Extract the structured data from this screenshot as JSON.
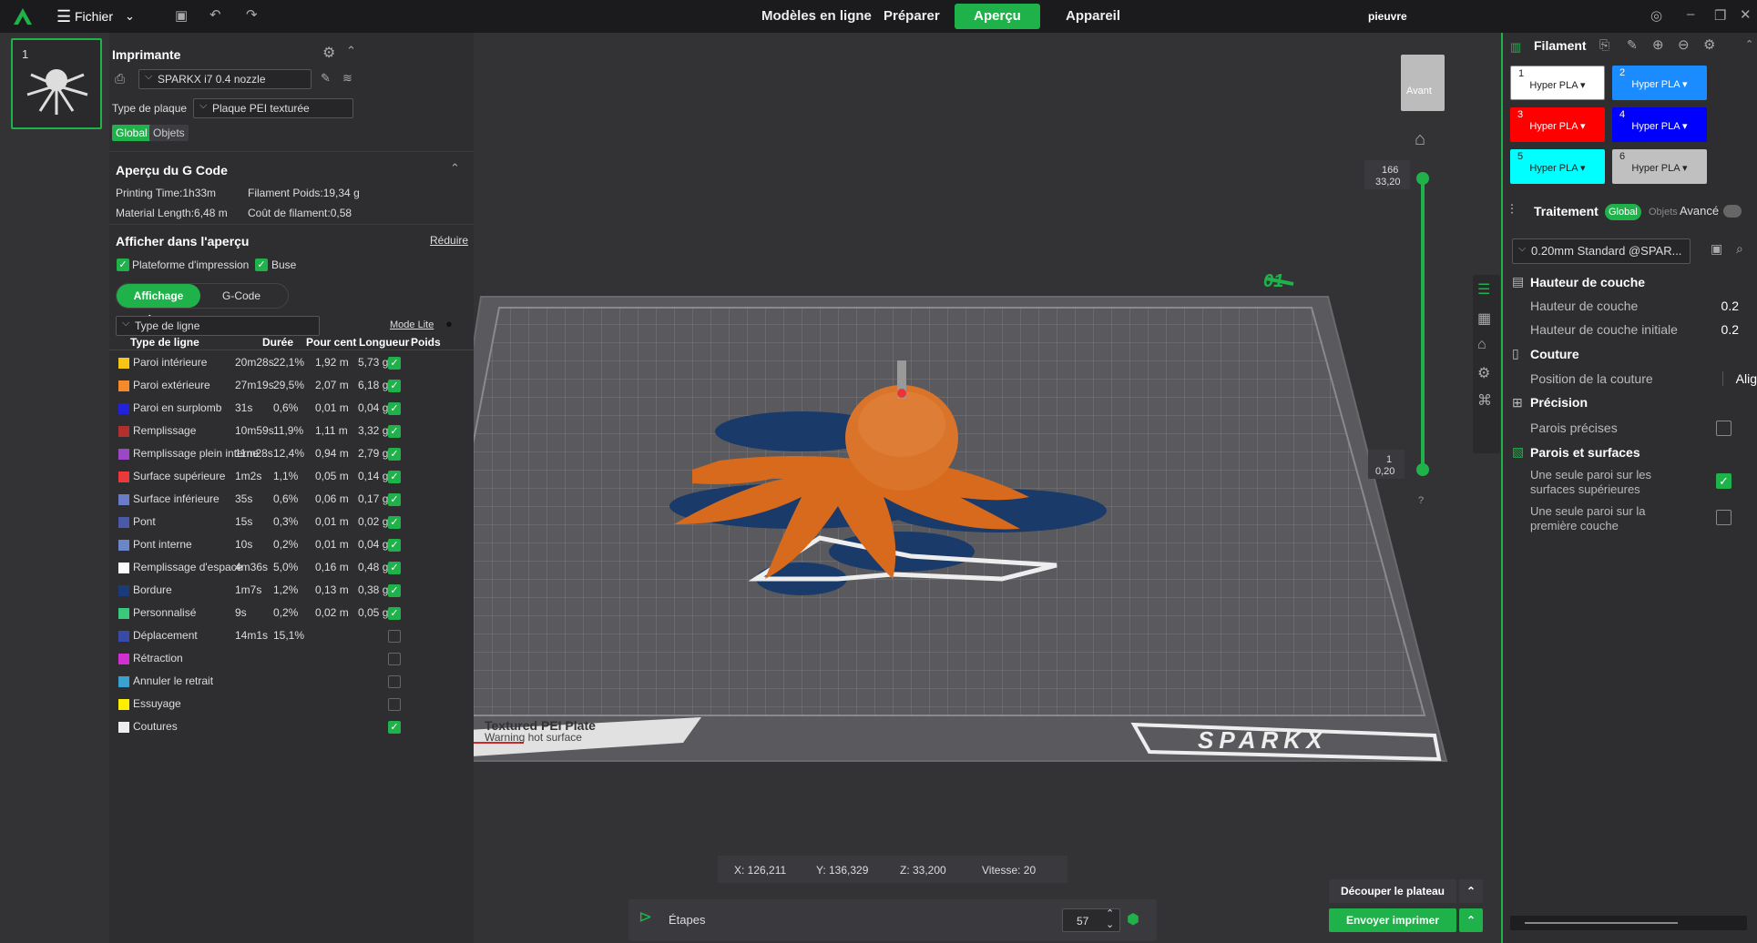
{
  "topbar": {
    "menu_label": "Fichier",
    "tabs": [
      "Modèles en ligne",
      "Préparer",
      "Aperçu",
      "Appareil"
    ],
    "active_tab": "Aperçu",
    "project_name": "pieuvre"
  },
  "thumbnail": {
    "plate_number": "1"
  },
  "printer": {
    "title": "Imprimante",
    "printer_name": "SPARKX i7 0.4 nozzle",
    "plate_type_label": "Type de plaque",
    "plate_type_value": "Plaque PEI texturée",
    "toggle_global": "Global",
    "toggle_objects": "Objets"
  },
  "gcode": {
    "title": "Aperçu du G Code",
    "printing_time": "Printing Time:1h33m",
    "filament_weight": "Filament Poids:19,34 g",
    "material_length": "Material Length:6,48 m",
    "filament_cost": "Coût de filament:0,58"
  },
  "display": {
    "title": "Afficher dans l'aperçu",
    "reduce": "Réduire",
    "cb_platform": "Plateforme d'impression",
    "cb_nozzle": "Buse",
    "tab_display": "Affichage des...",
    "tab_gcode": "G-Code",
    "line_type_select": "Type de ligne",
    "mode_lite": "Mode Lite",
    "columns": [
      "Type de ligne",
      "Durée",
      "Pour cent",
      "Longueur",
      "Poids"
    ],
    "rows": [
      {
        "name": "Paroi intérieure",
        "dur": "20m28s",
        "pct": "22,1%",
        "len": "1,92 m",
        "w": "5,73 g",
        "color": "#f5c518",
        "checked": true
      },
      {
        "name": "Paroi extérieure",
        "dur": "27m19s",
        "pct": "29,5%",
        "len": "2,07 m",
        "w": "6,18 g",
        "color": "#f58a2a",
        "checked": true
      },
      {
        "name": "Paroi en surplomb",
        "dur": "31s",
        "pct": "0,6%",
        "len": "0,01 m",
        "w": "0,04 g",
        "color": "#2222dd",
        "checked": true
      },
      {
        "name": "Remplissage",
        "dur": "10m59s",
        "pct": "11,9%",
        "len": "1,11 m",
        "w": "3,32 g",
        "color": "#b03030",
        "checked": true
      },
      {
        "name": "Remplissage plein interne",
        "dur": "11m28s",
        "pct": "12,4%",
        "len": "0,94 m",
        "w": "2,79 g",
        "color": "#9a48c8",
        "checked": true
      },
      {
        "name": "Surface supérieure",
        "dur": "1m2s",
        "pct": "1,1%",
        "len": "0,05 m",
        "w": "0,14 g",
        "color": "#e83a3a",
        "checked": true
      },
      {
        "name": "Surface inférieure",
        "dur": "35s",
        "pct": "0,6%",
        "len": "0,06 m",
        "w": "0,17 g",
        "color": "#6a7cc8",
        "checked": true
      },
      {
        "name": "Pont",
        "dur": "15s",
        "pct": "0,3%",
        "len": "0,01 m",
        "w": "0,02 g",
        "color": "#4a5aa8",
        "checked": true
      },
      {
        "name": "Pont interne",
        "dur": "10s",
        "pct": "0,2%",
        "len": "0,01 m",
        "w": "0,04 g",
        "color": "#6a86c8",
        "checked": true
      },
      {
        "name": "Remplissage d'espace",
        "dur": "4m36s",
        "pct": "5,0%",
        "len": "0,16 m",
        "w": "0,48 g",
        "color": "#ffffff",
        "checked": true
      },
      {
        "name": "Bordure",
        "dur": "1m7s",
        "pct": "1,2%",
        "len": "0,13 m",
        "w": "0,38 g",
        "color": "#1a3a7a",
        "checked": true
      },
      {
        "name": "Personnalisé",
        "dur": "9s",
        "pct": "0,2%",
        "len": "0,02 m",
        "w": "0,05 g",
        "color": "#3ac87a",
        "checked": true
      },
      {
        "name": "Déplacement",
        "dur": "14m1s",
        "pct": "15,1%",
        "len": "",
        "w": "",
        "color": "#3a4aa8",
        "checked": false
      },
      {
        "name": "Rétraction",
        "dur": "",
        "pct": "",
        "len": "",
        "w": "",
        "color": "#d030d0",
        "checked": false
      },
      {
        "name": "Annuler le retrait",
        "dur": "",
        "pct": "",
        "len": "",
        "w": "",
        "color": "#3aa0d0",
        "checked": false
      },
      {
        "name": "Essuyage",
        "dur": "",
        "pct": "",
        "len": "",
        "w": "",
        "color": "#ffee00",
        "checked": false
      },
      {
        "name": "Coutures",
        "dur": "",
        "pct": "",
        "len": "",
        "w": "",
        "color": "#eeeeee",
        "checked": true
      }
    ]
  },
  "viewport": {
    "view_cube_label": "Avant",
    "layer_top": "166",
    "layer_top_height": "33,20",
    "layer_bottom": "1",
    "layer_bottom_height": "0,20",
    "help": "?",
    "plate_number": "01",
    "plate_text_1": "Textured PEI Plate",
    "plate_text_2": "Warning hot surface",
    "brand": "SPARKX",
    "coord_x": "X: 126,211",
    "coord_y": "Y: 136,329",
    "coord_z": "Z: 33,200",
    "speed": "Vitesse: 20",
    "steps_label": "Étapes",
    "steps_value": "57",
    "btn_slice": "Découper le plateau",
    "btn_send": "Envoyer imprimer"
  },
  "filament": {
    "title": "Filament",
    "slots": [
      {
        "n": "1",
        "type": "Hyper PLA",
        "bg": "#ffffff",
        "fg": "#222222"
      },
      {
        "n": "2",
        "type": "Hyper PLA",
        "bg": "#1a8cff",
        "fg": "#ffffff"
      },
      {
        "n": "3",
        "type": "Hyper PLA",
        "bg": "#ff0000",
        "fg": "#ffffff"
      },
      {
        "n": "4",
        "type": "Hyper PLA",
        "bg": "#0000ff",
        "fg": "#ffffff"
      },
      {
        "n": "5",
        "type": "Hyper PLA",
        "bg": "#00ffff",
        "fg": "#222222"
      },
      {
        "n": "6",
        "type": "Hyper PLA",
        "bg": "#c0c0c0",
        "fg": "#222222"
      }
    ]
  },
  "process": {
    "title": "Traitement",
    "global": "Global",
    "objects": "Objets",
    "advanced": "Avancé",
    "profile": "0.20mm Standard @SPAR...",
    "sec_layer": "Hauteur de couche",
    "layer_height_label": "Hauteur de couche",
    "layer_height_val": "0.2",
    "initial_layer_label": "Hauteur de couche initiale",
    "initial_layer_val": "0.2",
    "sec_seam": "Couture",
    "seam_pos_label": "Position de la couture",
    "seam_pos_val": "Alig",
    "sec_precision": "Précision",
    "precise_walls": "Parois précises",
    "sec_walls": "Parois et surfaces",
    "single_wall_top": "Une seule paroi sur les surfaces supérieures",
    "single_wall_first": "Une seule paroi sur la première couche"
  }
}
